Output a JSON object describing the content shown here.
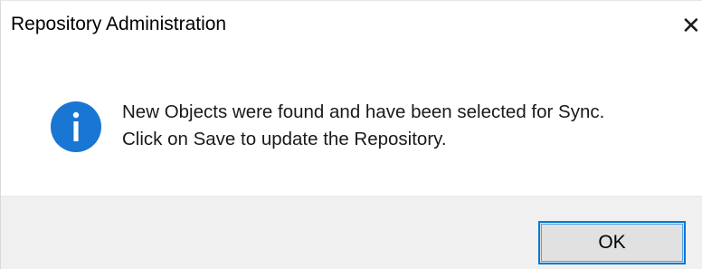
{
  "window": {
    "title": "Repository Administration",
    "close_glyph": "✕"
  },
  "message": {
    "icon": "info-icon",
    "line1": "New Objects were found and have been selected for Sync.",
    "line2": "Click on Save to update the Repository."
  },
  "buttons": {
    "ok_label": "OK"
  },
  "colors": {
    "accent": "#0078d7",
    "icon_fill": "#1976d2",
    "footer_bg": "#f0f0f0",
    "button_bg": "#e1e1e1"
  }
}
